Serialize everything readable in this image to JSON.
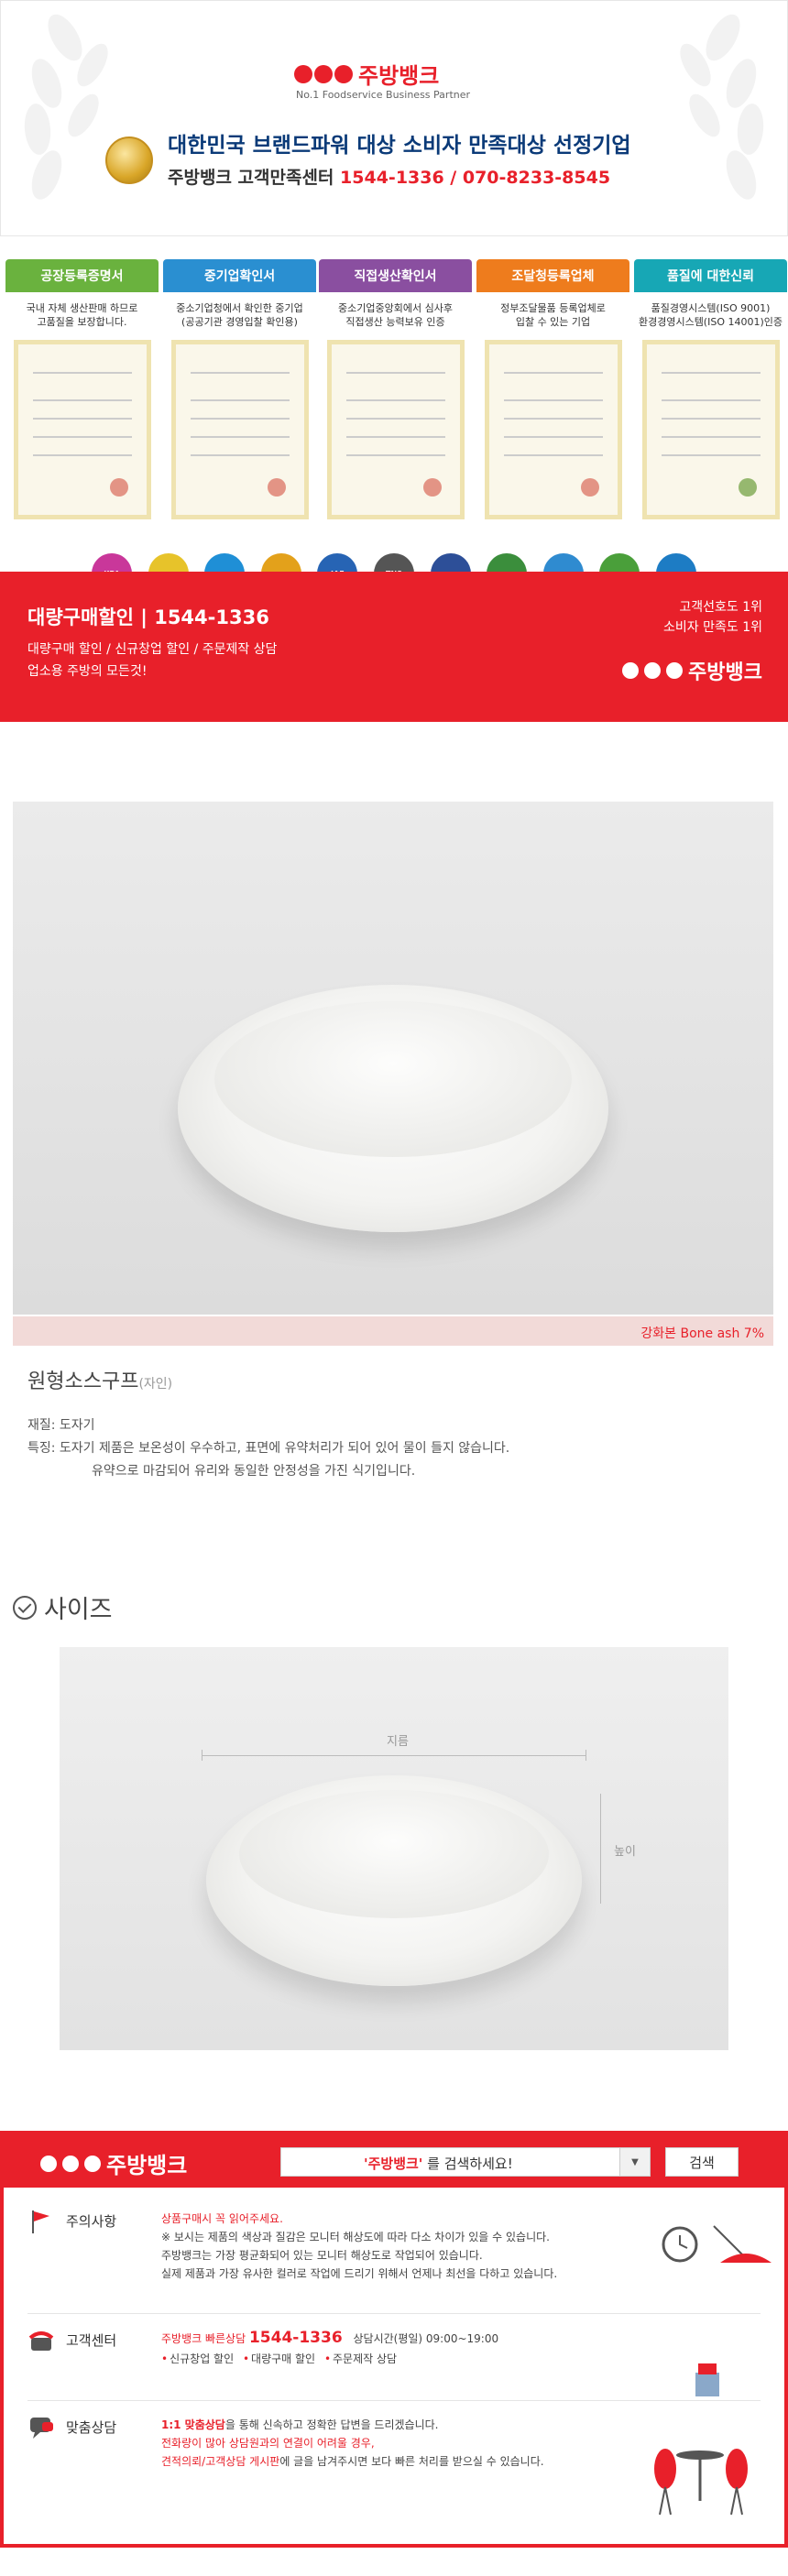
{
  "header": {
    "brand_name": "주방뱅크",
    "brand_sub": "No.1 Foodservice Business Partner",
    "award_title": "대한민국 브랜드파워 대상 소비자 만족대상 선정기업",
    "contact_label": "주방뱅크 고객만족센터",
    "contact_numbers": "1544-1336 / 070-8233-8545"
  },
  "certificates": [
    {
      "title": "공장등록증명서",
      "desc1": "국내 자체 생산판매 하므로",
      "desc2": "고품질을 보장합니다.",
      "color": "#6ab23e"
    },
    {
      "title": "중기업확인서",
      "desc1": "중소기업청에서 확인한 중기업",
      "desc2": "(공공기관 경영입찰 확인용)",
      "color": "#2a8fd1"
    },
    {
      "title": "직접생산확인서",
      "desc1": "중소기업중앙회에서 심사후",
      "desc2": "직접생산 능력보유 인증",
      "color": "#8a4fa0"
    },
    {
      "title": "조달청등록업체",
      "desc1": "정부조달물품 등록업체로",
      "desc2": "입찰 수 있는 기업",
      "color": "#ee7c1d"
    },
    {
      "title": "품질에 대한신뢰",
      "desc1": "품질경영시스템(ISO 9001)",
      "desc2": "환경경영시스템(ISO 14001)인증",
      "color": "#17a7b5"
    }
  ],
  "badges": [
    {
      "name": "kpa-badge-icon",
      "label": "KPA",
      "color": "#c9379a"
    },
    {
      "name": "award-badge-icon",
      "label": "",
      "color": "#e7c32a"
    },
    {
      "name": "c-badge-icon",
      "label": "",
      "color": "#1f8fd6"
    },
    {
      "name": "seal-badge-icon",
      "label": "",
      "color": "#e3a11b"
    },
    {
      "name": "iaf-badge-icon",
      "label": "IAF",
      "color": "#2764b4"
    },
    {
      "name": "tns-badge-icon",
      "label": "TNS",
      "color": "#555555"
    },
    {
      "name": "iso-badge-icon",
      "label": "",
      "color": "#2d4f98"
    },
    {
      "name": "bird-badge-icon",
      "label": "",
      "color": "#3b8e3c"
    },
    {
      "name": "star-badge-icon",
      "label": "",
      "color": "#2f8bd0"
    },
    {
      "name": "e-badge-icon",
      "label": "",
      "color": "#4a9f3a"
    },
    {
      "name": "globe-badge-icon",
      "label": "",
      "color": "#1d7cc4"
    }
  ],
  "promo": {
    "title": "대량구매할인 | 1544-1336",
    "line1": "대량구매 할인 / 신규창업 할인 / 주문제작 상담",
    "line2": "업소용 주방의 모든것!",
    "right1": "고객선호도 1위",
    "right2": "소비자 만족도 1위",
    "logo": "주방뱅크"
  },
  "product": {
    "material_tag": "강화본 Bone ash 7%",
    "title": "원형소스구프",
    "origin": "(자인)",
    "material": "재질: 도자기",
    "feature1": "특징: 도자기 제품은 보온성이 우수하고, 표면에 유약처리가 되어 있어 물이 들지 않습니다.",
    "feature2": "유약으로 마감되어 유리와 동일한 안정성을 가진 식기입니다."
  },
  "size_section": {
    "title": "사이즈",
    "width_label": "지름",
    "height_label": "높이"
  },
  "info": {
    "logo": "주방뱅크",
    "search_query": "'주방뱅크'",
    "search_suffix": " 를 검색하세요!",
    "search_button": "검색",
    "notice_label": "주의사항",
    "notice_head": "상품구매시 꼭 읽어주세요.",
    "notice_1": "※ 보시는 제품의 색상과 질감은 모니터 해상도에 따라 다소 차이가 있을 수 있습니다.",
    "notice_2": "주방뱅크는 가장 평균화되어 있는 모니터 해상도로 작업되어 있습니다.",
    "notice_3": "실제 제품과 가장 유사한 컬러로 작업에 드리기 위해서 언제나 최선을 다하고 있습니다.",
    "center_label": "고객센터",
    "center_head": "주방뱅크 빠른상담",
    "center_phone": "1544-1336",
    "center_hours": "상담시간(평일) 09:00~19:00",
    "center_items": [
      "신규창업 할인",
      "대량구매 할인",
      "주문제작 상담"
    ],
    "consult_label": "맞춤상담",
    "consult_head": "1:1 맞춤상담",
    "consult_head_rest": "을 통해 신속하고 정확한 답변을 드리겠습니다.",
    "consult_red1": "전화량이 많아 상담원과의 연결이 어려울 경우,",
    "consult_red2": "견적의뢰/고객상담 게시판",
    "consult_rest2": "에 글을 남겨주시면 보다 빠른 처리를 받으실 수 있습니다."
  }
}
